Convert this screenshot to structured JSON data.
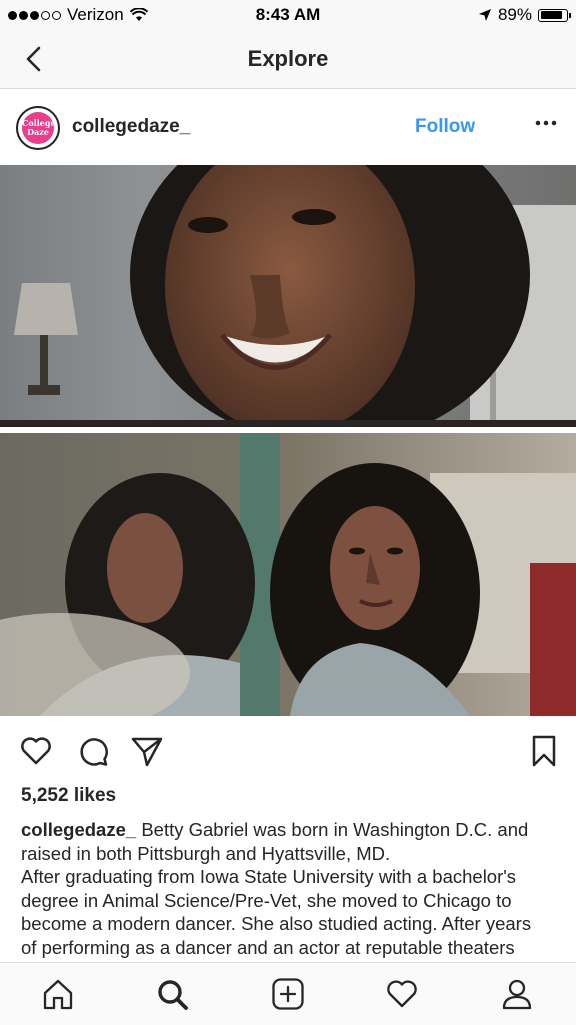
{
  "status_bar": {
    "carrier": "Verizon",
    "time": "8:43 AM",
    "battery": "89%",
    "battery_level": 0.89
  },
  "nav": {
    "title": "Explore",
    "back_icon": "chevron-left-icon"
  },
  "post": {
    "avatar_text": "College Daze",
    "username": "collegedaze_",
    "follow_label": "Follow",
    "more_icon": "more-horizontal-icon",
    "likes": "5,252 likes",
    "caption_user": "collegedaze_",
    "caption_line1": "Betty Gabriel was born in Washington D.C. and raised in both Pittsburgh and Hyattsville, MD.",
    "caption_line2": "After graduating from Iowa State University with a bachelor's degree in Animal Science/Pre-Vet, she moved to Chicago to become a modern dancer. She also studied acting. After years of performing as a dancer and an actor at reputable theaters such as Steppenwolf and Victory"
  },
  "actions": {
    "like_icon": "heart-icon",
    "comment_icon": "comment-icon",
    "share_icon": "send-icon",
    "save_icon": "bookmark-icon"
  },
  "tab_bar": {
    "home_icon": "home-icon",
    "search_icon": "search-icon",
    "add_icon": "add-post-icon",
    "activity_icon": "heart-icon",
    "profile_icon": "profile-icon"
  },
  "colors": {
    "accent": "#3897f0",
    "text": "#262626",
    "bar_bg": "#f8f8f8",
    "divider": "#dbdbdb"
  }
}
